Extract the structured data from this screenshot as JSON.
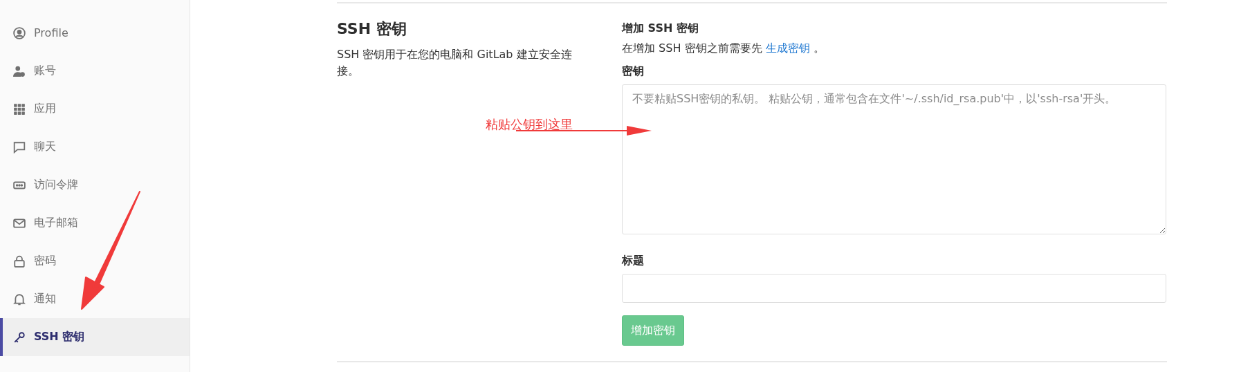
{
  "sidebar": {
    "items": [
      {
        "label": "Profile",
        "kind": "profile",
        "selected": false
      },
      {
        "label": "账号",
        "kind": "account",
        "selected": false
      },
      {
        "label": "应用",
        "kind": "apps",
        "selected": false
      },
      {
        "label": "聊天",
        "kind": "chat",
        "selected": false
      },
      {
        "label": "访问令牌",
        "kind": "token",
        "selected": false
      },
      {
        "label": "电子邮箱",
        "kind": "mail",
        "selected": false
      },
      {
        "label": "密码",
        "kind": "lock",
        "selected": false
      },
      {
        "label": "通知",
        "kind": "bell",
        "selected": false
      },
      {
        "label": "SSH 密钥",
        "kind": "key",
        "selected": true
      }
    ]
  },
  "intro": {
    "title": "SSH 密钥",
    "description": "SSH 密钥用于在您的电脑和 GitLab 建立安全连接。"
  },
  "form": {
    "title": "增加 SSH 密钥",
    "hint": "在增加 SSH 密钥之前需要先",
    "hint_link": "生成密钥",
    "hint_end": "。",
    "key_label": "密钥",
    "key_placeholder": "不要粘贴SSH密钥的私钥。 粘贴公钥，通常包含在文件'~/.ssh/id_rsa.pub'中，以'ssh-rsa'开头。",
    "title_label": "标题",
    "submit": "增加密钥",
    "submit_disabled": true
  },
  "annotation": {
    "text": "粘贴公钥到这里"
  }
}
